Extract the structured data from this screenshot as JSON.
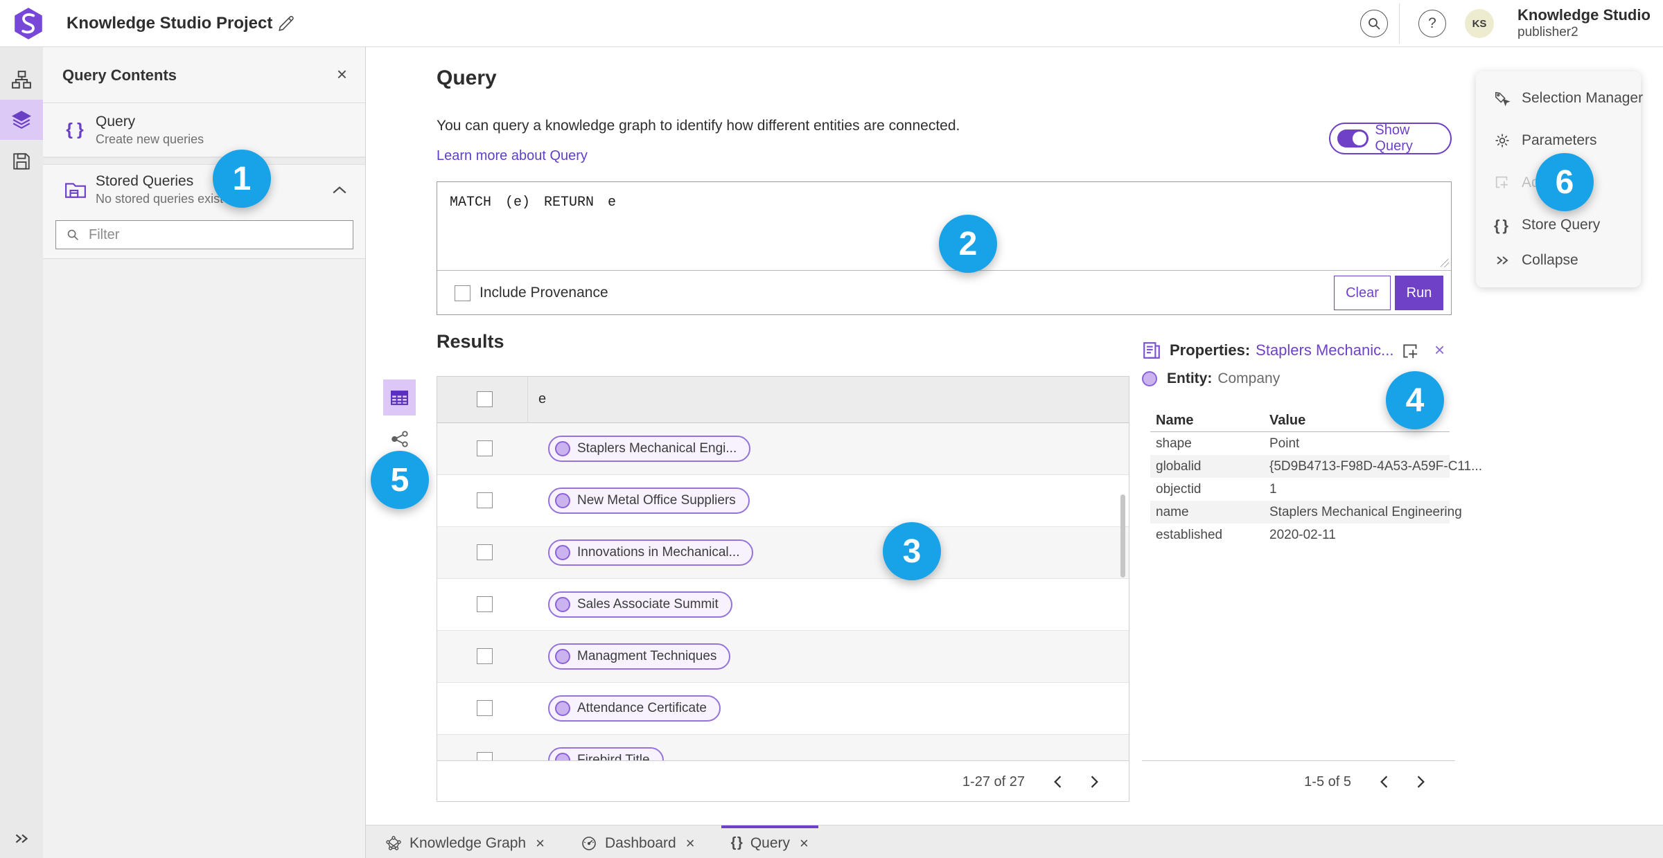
{
  "colors": {
    "accent": "#6e41c7",
    "accent_light": "#9473da",
    "pill_fill": "#f7f2fe",
    "pill_dot": "#cbb3f0",
    "annotation_blue": "#18a2e8",
    "rail_selected_bg": "#ddc9f6",
    "avatar_bg": "#edecd0"
  },
  "header": {
    "title": "Knowledge Studio Project",
    "user_name": "Knowledge Studio",
    "user_role": "publisher2",
    "avatar_initials": "KS",
    "help_glyph": "?"
  },
  "contents_panel": {
    "title": "Query Contents",
    "close_glyph": "×",
    "items": [
      {
        "title": "Query",
        "subtitle": "Create new queries"
      },
      {
        "title": "Stored Queries",
        "subtitle": "No stored queries exist"
      }
    ],
    "filter_placeholder": "Filter"
  },
  "query_section": {
    "title": "Query",
    "description": "You can query a knowledge graph to identify how different entities are connected.",
    "learn_more": "Learn more about Query",
    "show_query_label": "Show Query",
    "query_text": "MATCH (e) RETURN e",
    "include_provenance_label": "Include Provenance",
    "clear_label": "Clear",
    "run_label": "Run"
  },
  "results": {
    "title": "Results",
    "column_header": "e",
    "rows": [
      "Staplers Mechanical Engi...",
      "New Metal Office Suppliers",
      "Innovations in Mechanical...",
      "Sales Associate Summit",
      "Managment Techniques",
      "Attendance Certificate",
      "Firebird Title"
    ],
    "pagination": "1-27 of 27"
  },
  "properties_panel": {
    "title": "Properties:",
    "entity_link": "Staplers Mechanic...",
    "close_glyph": "×",
    "entity_label": "Entity:",
    "entity_type": "Company",
    "columns": {
      "name": "Name",
      "value": "Value"
    },
    "rows": [
      {
        "name": "shape",
        "value": "Point"
      },
      {
        "name": "globalid",
        "value": "{5D9B4713-F98D-4A53-A59F-C11..."
      },
      {
        "name": "objectid",
        "value": "1"
      },
      {
        "name": "name",
        "value": "Staplers Mechanical Engineering"
      },
      {
        "name": "established",
        "value": "2020-02-11"
      }
    ],
    "pagination": "1-5 of 5"
  },
  "tools_menu": {
    "items": [
      {
        "label": "Selection Manager"
      },
      {
        "label": "Parameters"
      },
      {
        "label": "Ad"
      },
      {
        "label": "Store Query"
      },
      {
        "label": "Collapse"
      }
    ]
  },
  "tabbar": {
    "tabs": [
      {
        "label": "Knowledge Graph",
        "close": "×"
      },
      {
        "label": "Dashboard",
        "close": "×"
      },
      {
        "label": "Query",
        "close": "×"
      }
    ]
  },
  "annotations": [
    "1",
    "2",
    "3",
    "4",
    "5",
    "6"
  ]
}
